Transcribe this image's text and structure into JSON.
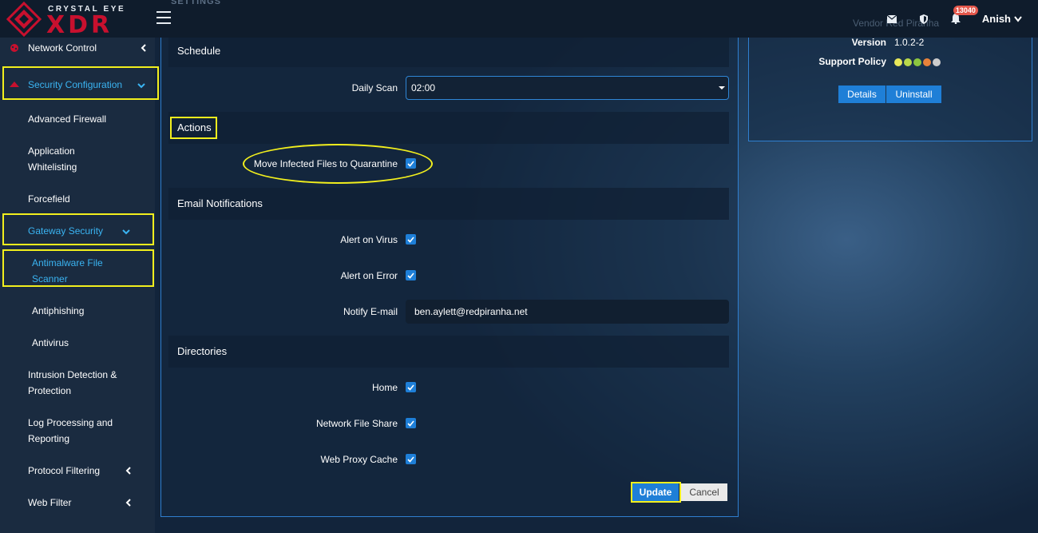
{
  "header": {
    "logo_top": "CRYSTAL EYE",
    "logo_main": "XDR",
    "page_title_ghost": "SETTINGS",
    "notification_count": "13040",
    "username": "Anish",
    "vendor_ghost": "Vendor  Red Piranha"
  },
  "sidebar": {
    "items": [
      {
        "label": "Network Control"
      },
      {
        "label": "Security Configuration"
      },
      {
        "label": "Advanced Firewall"
      },
      {
        "label": "Application Whitelisting"
      },
      {
        "label": "Forcefield"
      },
      {
        "label": "Gateway Security"
      },
      {
        "label": "Antimalware File Scanner"
      },
      {
        "label": "Antiphishing"
      },
      {
        "label": "Antivirus"
      },
      {
        "label": "Intrusion Detection & Protection"
      },
      {
        "label": "Log Processing and Reporting"
      },
      {
        "label": "Protocol Filtering"
      },
      {
        "label": "Web Filter"
      }
    ]
  },
  "form": {
    "schedule_title": "Schedule",
    "daily_scan_label": "Daily Scan",
    "daily_scan_value": "02:00",
    "actions_title": "Actions",
    "move_infected_label": "Move Infected Files to Quarantine",
    "email_title": "Email Notifications",
    "alert_virus_label": "Alert on Virus",
    "alert_error_label": "Alert on Error",
    "notify_email_label": "Notify E-mail",
    "notify_email_value": "ben.aylett@redpiranha.net",
    "directories_title": "Directories",
    "home_label": "Home",
    "nfs_label": "Network File Share",
    "proxy_label": "Web Proxy Cache",
    "update_label": "Update",
    "cancel_label": "Cancel"
  },
  "info": {
    "version_label": "Version",
    "version_value": "1.0.2-2",
    "support_label": "Support Policy",
    "support_colors": [
      "#e8e85a",
      "#b9d84a",
      "#8cc63f",
      "#e8823a",
      "#cccccc"
    ],
    "details_label": "Details",
    "uninstall_label": "Uninstall"
  },
  "colors": {
    "accent": "#1f7fd7",
    "highlight": "#f2ef1d",
    "brand_red": "#c8102e"
  }
}
